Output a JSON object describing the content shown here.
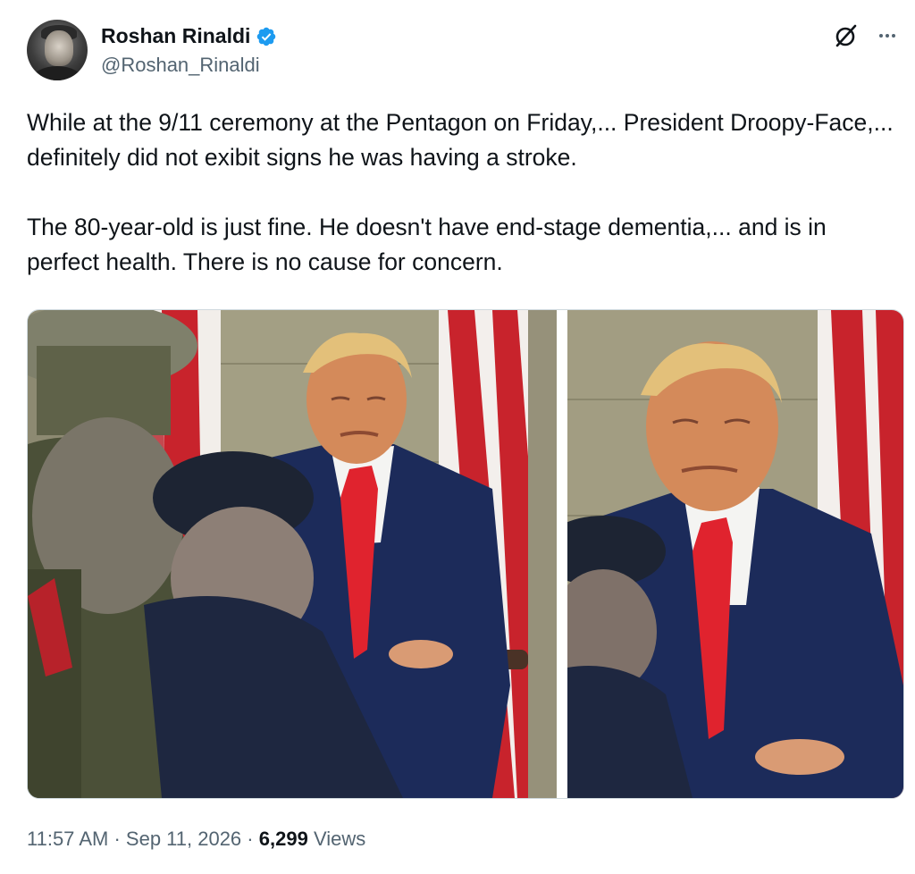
{
  "author": {
    "display_name": "Roshan Rinaldi",
    "handle": "@Roshan_Rinaldi",
    "verified": true,
    "verified_color": "#1d9bf0"
  },
  "header_actions": {
    "grok_icon": "slashed-circle-icon",
    "more_icon": "more-horizontal-icon"
  },
  "tweet": {
    "paragraphs": [
      "While at the 9/11 ceremony at the Pentagon on Friday,... President Droopy-Face,... definitely did not exibit signs he was having a stroke.",
      "The 80-year-old is just fine. He doesn't have end-stage dementia,... and is in perfect health. There is no cause for concern."
    ]
  },
  "media": {
    "photo_count": 2,
    "photos": [
      "photo",
      "photo"
    ]
  },
  "footer": {
    "time": "11:57 AM",
    "separator": "·",
    "date": "Sep 11, 2026",
    "views_count": "6,299",
    "views_label": "Views"
  },
  "colors": {
    "text_primary": "#0f1419",
    "text_secondary": "#536471",
    "border": "#cfd9de"
  }
}
